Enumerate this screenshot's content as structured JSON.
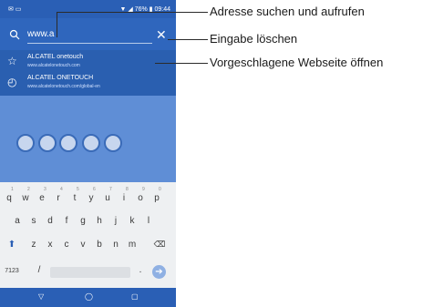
{
  "status_bar": {
    "time": "09:44",
    "battery_text": "76%"
  },
  "search": {
    "text": "www.a"
  },
  "suggestions": [
    {
      "title": "ALCATEL onetouch",
      "url": "www.alcatelonetouch.com"
    },
    {
      "title": "ALCATEL ONETOUCH",
      "url": "www.alcatelonetouch.com/global-en"
    }
  ],
  "keyboard": {
    "row1": [
      "q",
      "w",
      "e",
      "r",
      "t",
      "y",
      "u",
      "i",
      "o",
      "p"
    ],
    "row1_nums": [
      "1",
      "2",
      "3",
      "4",
      "5",
      "6",
      "7",
      "8",
      "9",
      "0"
    ],
    "row2": [
      "a",
      "s",
      "d",
      "f",
      "g",
      "h",
      "j",
      "k",
      "l"
    ],
    "row3": [
      "z",
      "x",
      "c",
      "v",
      "b",
      "n",
      "m"
    ],
    "row4": {
      "symbols": "7123",
      "slash": "/",
      "dot": "."
    }
  },
  "annotations": [
    {
      "text": "Adresse suchen und aufrufen"
    },
    {
      "text": "Eingabe löschen"
    },
    {
      "text": "Vorgeschlagene Webseite öffnen"
    }
  ],
  "colors": {
    "accent": "#2a5fb5",
    "callout_line": "#2b2b2b"
  }
}
